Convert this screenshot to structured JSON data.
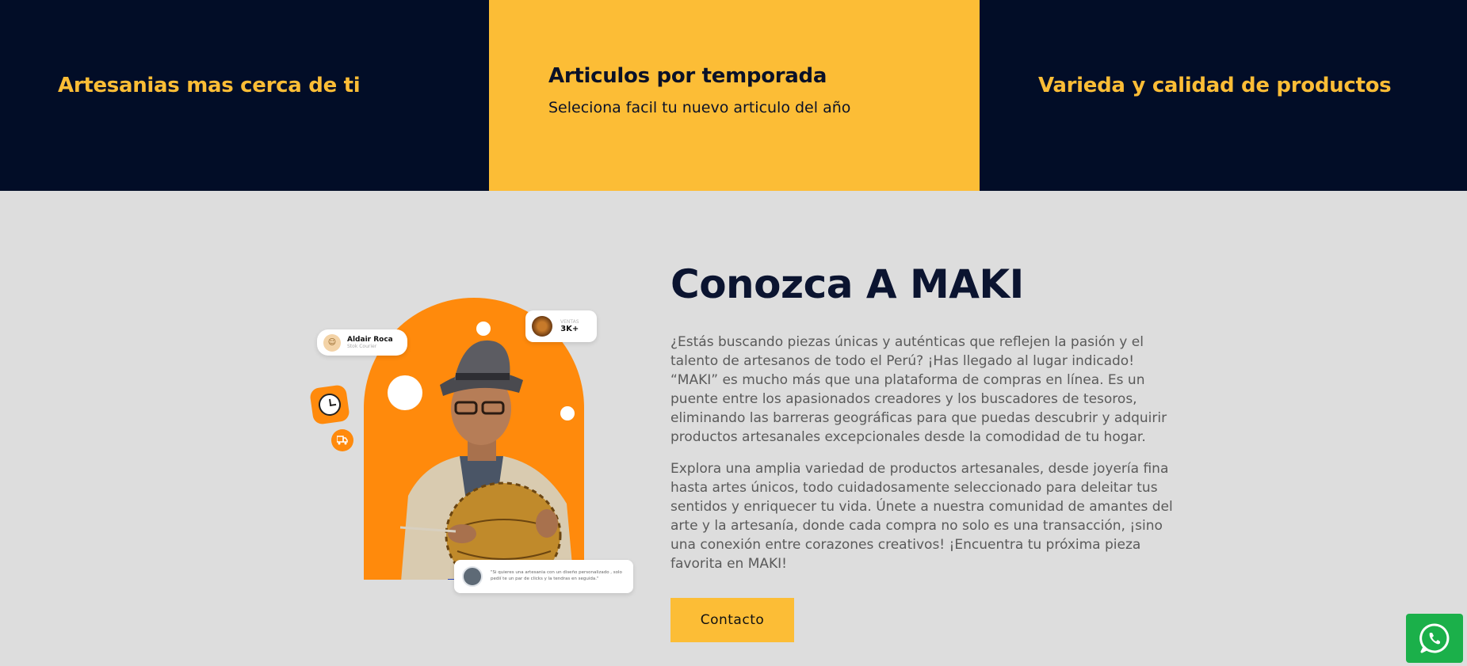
{
  "features": [
    {
      "title": "Artesanias mas cerca de ti",
      "subtitle": ""
    },
    {
      "title": "Articulos por temporada",
      "subtitle": "Seleciona facil tu nuevo articulo del año"
    },
    {
      "title": "Varieda y calidad de productos",
      "subtitle": ""
    }
  ],
  "about": {
    "title": "Conozca A MAKI",
    "paragraph1": "¿Estás buscando piezas únicas y auténticas que reflejen la pasión y el talento de artesanos de todo el Perú? ¡Has llegado al lugar indicado! “MAKI” es mucho más que una plataforma de compras en línea. Es un puente entre los apasionados creadores y los buscadores de tesoros, eliminando las barreras geográficas para que puedas descubrir y adquirir productos artesanales excepcionales desde la comodidad de tu hogar.",
    "paragraph2": "Explora una amplia variedad de productos artesanales, desde joyería fina hasta artes únicos, todo cuidadosamente seleccionado para deleitar tus sentidos y enriquecer tu vida. Únete a nuestra comunidad de amantes del arte y la artesanía, donde cada compra no solo es una transacción, ¡sino una conexión entre corazones creativos! ¡Encuentra tu próxima pieza favorita en MAKI!",
    "button_label": "Contacto"
  },
  "illustration": {
    "name_card": {
      "name": "Aldair Roca",
      "role": "Stok Courier"
    },
    "stat_card": {
      "label": "VENTAS",
      "value": "3K+"
    },
    "quote_card": {
      "text": "\"Si quieres una artesania con un diseño personalizado , solo pedií te un par de clicks y la tendras en seguida.\""
    }
  },
  "colors": {
    "dark": "#020d27",
    "yellow": "#fcbd36",
    "orange": "#ff8a0c",
    "whatsapp": "#1bb04a"
  },
  "icons": [
    "clock-icon",
    "truck-icon",
    "whatsapp-icon"
  ]
}
